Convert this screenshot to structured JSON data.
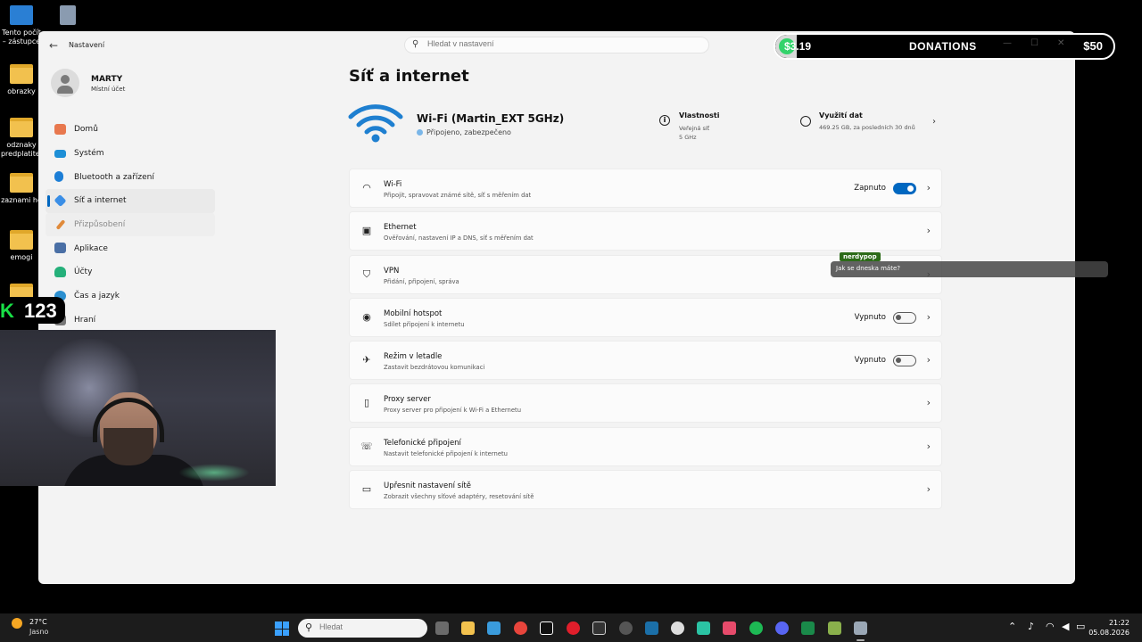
{
  "desktop": {
    "icons": [
      {
        "label": "Tento počít – zástupce"
      },
      {
        "label": "obrazky"
      },
      {
        "label": "odznaky predplatitel"
      },
      {
        "label": "zaznami he"
      },
      {
        "label": "emogi"
      }
    ]
  },
  "window": {
    "title": "Nastavení",
    "search_placeholder": "Hledat v nastavení"
  },
  "user": {
    "name": "MARTY",
    "account": "Místní účet"
  },
  "nav": [
    {
      "label": "Domů",
      "icon": "home-icon",
      "color": "#e8784e"
    },
    {
      "label": "Systém",
      "icon": "monitor-icon",
      "color": "#1e8fd6"
    },
    {
      "label": "Bluetooth a zařízení",
      "icon": "bluetooth-icon",
      "color": "#1c7ed6"
    },
    {
      "label": "Síť a internet",
      "icon": "wifi-diamond-icon",
      "color": "#3a8ee6"
    },
    {
      "label": "Přizpůsobení",
      "icon": "brush-icon",
      "color": "#e08a3a"
    },
    {
      "label": "Aplikace",
      "icon": "apps-icon",
      "color": "#4a6fa5"
    },
    {
      "label": "Účty",
      "icon": "person-icon",
      "color": "#25b07a"
    },
    {
      "label": "Čas a jazyk",
      "icon": "globe-icon",
      "color": "#2b8fd0"
    },
    {
      "label": "Hraní",
      "icon": "gamepad-icon",
      "color": "#777777"
    }
  ],
  "page": {
    "title": "Síť a internet"
  },
  "hero": {
    "network_name": "Wi-Fi (Martin_EXT 5GHz)",
    "status": "Připojeno, zabezpečeno",
    "properties": {
      "title": "Vlastnosti",
      "line1": "Veřejná síť",
      "line2": "5 GHz"
    },
    "usage": {
      "title": "Využití dat",
      "subtitle": "469.25 GB, za posledních 30 dnů"
    }
  },
  "rows": [
    {
      "title": "Wi-Fi",
      "subtitle": "Připojit, spravovat známé sítě, síť s měřením dat",
      "state": "Zapnuto",
      "toggle": "on",
      "icon": "wifi-icon"
    },
    {
      "title": "Ethernet",
      "subtitle": "Ověřování, nastavení IP a DNS, síť s měřením dat",
      "state": "",
      "toggle": "none",
      "icon": "ethernet-icon"
    },
    {
      "title": "VPN",
      "subtitle": "Přidání, připojení, správa",
      "state": "",
      "toggle": "none",
      "icon": "shield-icon"
    },
    {
      "title": "Mobilní hotspot",
      "subtitle": "Sdílet připojení k internetu",
      "state": "Vypnuto",
      "toggle": "off",
      "icon": "hotspot-icon"
    },
    {
      "title": "Režim v letadle",
      "subtitle": "Zastavit bezdrátovou komunikaci",
      "state": "Vypnuto",
      "toggle": "off",
      "icon": "airplane-icon"
    },
    {
      "title": "Proxy server",
      "subtitle": "Proxy server pro připojení k Wi-Fi a Ethernetu",
      "state": "",
      "toggle": "none",
      "icon": "proxy-icon"
    },
    {
      "title": "Telefonické připojení",
      "subtitle": "Nastavit telefonické připojení k internetu",
      "state": "",
      "toggle": "none",
      "icon": "dialup-icon"
    },
    {
      "title": "Upřesnit nastavení sítě",
      "subtitle": "Zobrazit všechny síťové adaptéry, resetování sítě",
      "state": "",
      "toggle": "none",
      "icon": "computer-network-icon"
    }
  ],
  "donation": {
    "amount": "$3.19",
    "label": "DONATIONS",
    "goal": "$50",
    "progress_fraction": 0.064,
    "accent": "#33d36b"
  },
  "chat": {
    "user": "nerdypop",
    "message": "Jak se dneska máte?"
  },
  "overlay_counter": {
    "prefix": "K",
    "value": "123"
  },
  "taskbar": {
    "weather_temp": "27°C",
    "weather_desc": "Jasno",
    "search_placeholder": "Hledat",
    "time": "21:22",
    "date": "05.08.2026"
  }
}
